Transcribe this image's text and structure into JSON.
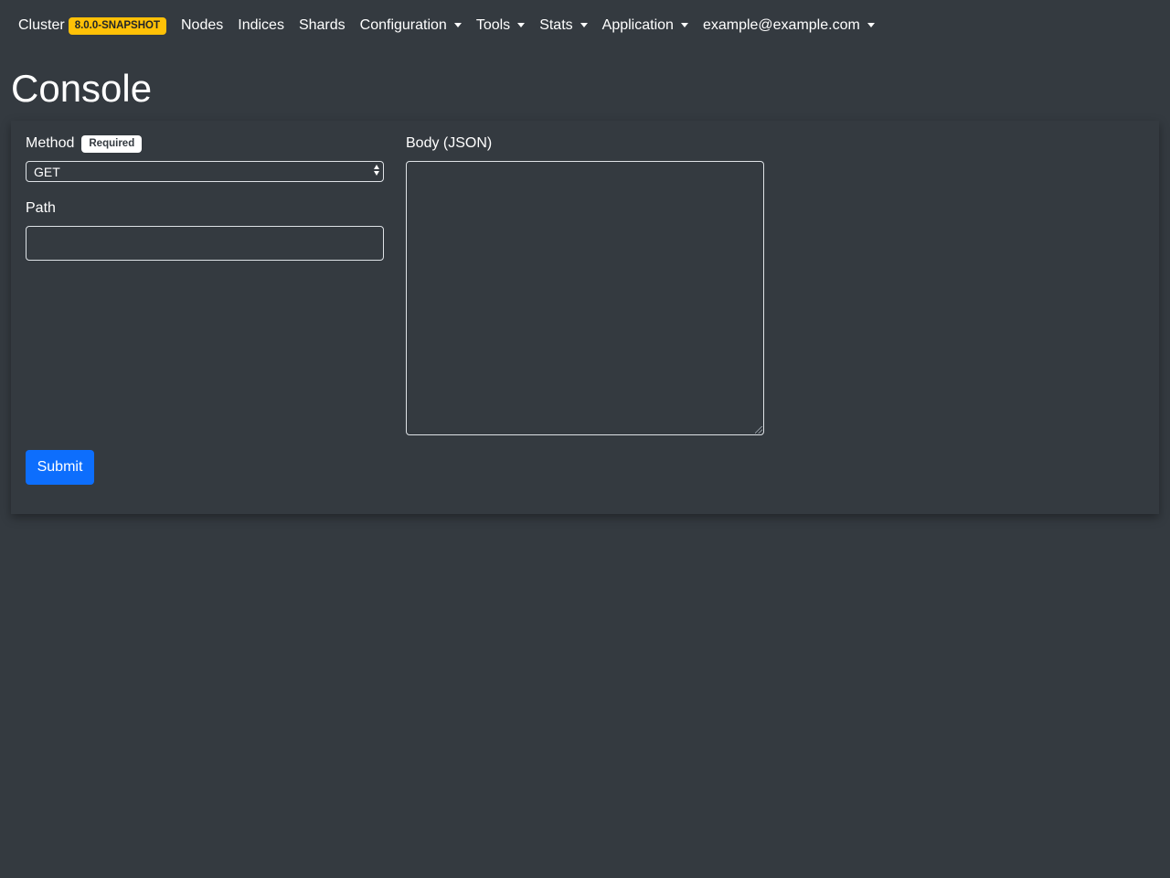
{
  "navbar": {
    "brand": "Cluster",
    "version_badge": "8.0.0-SNAPSHOT",
    "items": [
      {
        "label": "Nodes",
        "dropdown": false
      },
      {
        "label": "Indices",
        "dropdown": false
      },
      {
        "label": "Shards",
        "dropdown": false
      },
      {
        "label": "Configuration",
        "dropdown": true
      },
      {
        "label": "Tools",
        "dropdown": true
      },
      {
        "label": "Stats",
        "dropdown": true
      },
      {
        "label": "Application",
        "dropdown": true
      },
      {
        "label": "example@example.com",
        "dropdown": true
      }
    ]
  },
  "page": {
    "title": "Console"
  },
  "form": {
    "method_label": "Method",
    "required_badge": "Required",
    "method_value": "GET",
    "path_label": "Path",
    "path_value": "",
    "body_label": "Body (JSON)",
    "body_value": "",
    "submit_label": "Submit"
  },
  "colors": {
    "background": "#343a40",
    "version_badge": "#ffc107",
    "primary_button": "#0d6efd",
    "text": "#ffffff"
  }
}
